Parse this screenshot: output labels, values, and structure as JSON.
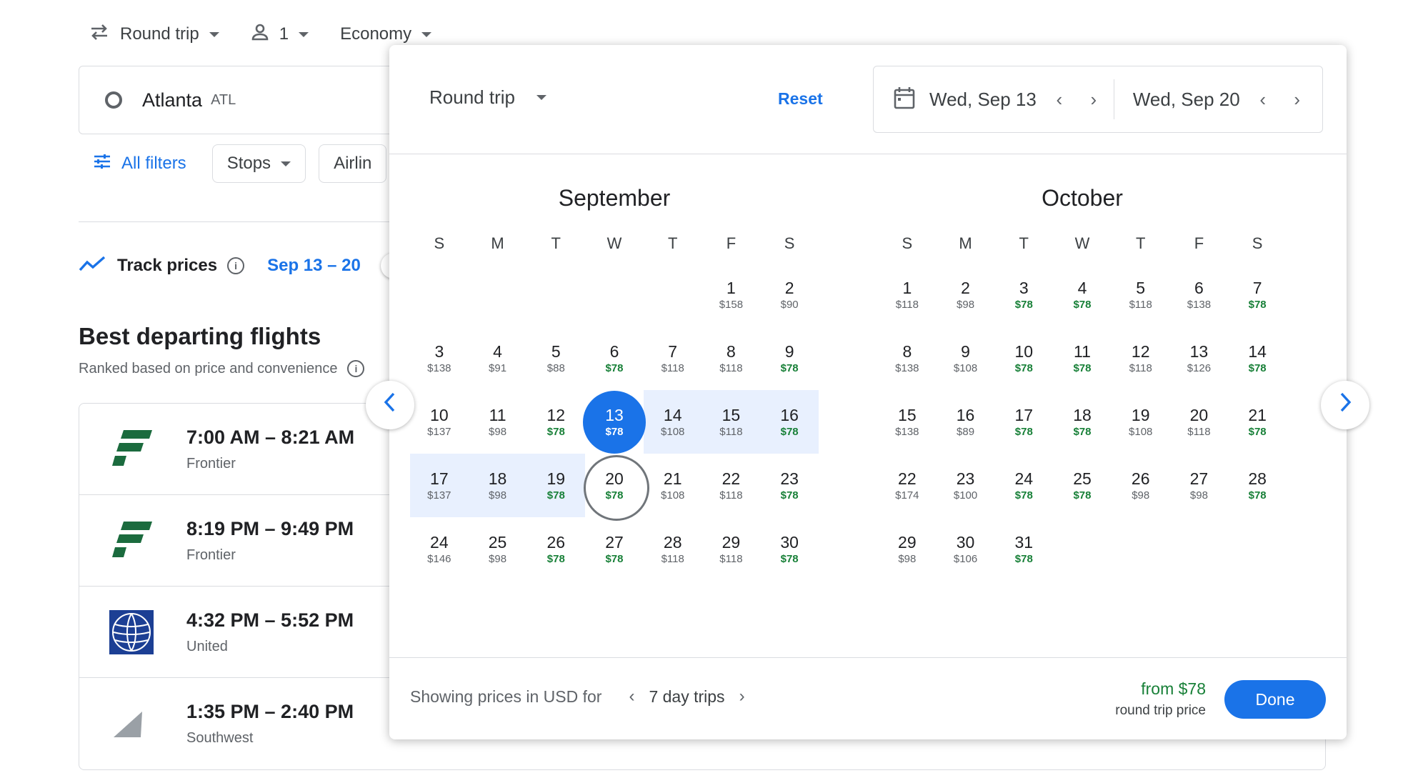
{
  "topbar": {
    "trip_type": "Round trip",
    "passengers": "1",
    "cabin": "Economy"
  },
  "search": {
    "origin_city": "Atlanta",
    "origin_code": "ATL"
  },
  "filters": {
    "all_filters": "All filters",
    "stops": "Stops",
    "airlines": "Airlin"
  },
  "track": {
    "label": "Track prices",
    "dates": "Sep 13 – 20"
  },
  "results": {
    "title": "Best departing flights",
    "subtitle": "Ranked based on price and convenience",
    "flights": [
      {
        "times": "7:00 AM – 8:21 AM",
        "airline": "Frontier"
      },
      {
        "times": "8:19 PM – 9:49 PM",
        "airline": "Frontier"
      },
      {
        "times": "4:32 PM – 5:52 PM",
        "airline": "United"
      },
      {
        "times": "1:35 PM – 2:40 PM",
        "airline": "Southwest"
      }
    ]
  },
  "popup": {
    "trip_type": "Round trip",
    "reset": "Reset",
    "depart_date": "Wed, Sep 13",
    "return_date": "Wed, Sep 20",
    "months": [
      {
        "name": "September",
        "weekdays": [
          "S",
          "M",
          "T",
          "W",
          "T",
          "F",
          "S"
        ],
        "days": [
          {
            "blank": true
          },
          {
            "blank": true
          },
          {
            "blank": true
          },
          {
            "blank": true
          },
          {
            "blank": true
          },
          {
            "d": "1",
            "p": "$158"
          },
          {
            "d": "2",
            "p": "$90"
          },
          {
            "d": "3",
            "p": "$138"
          },
          {
            "d": "4",
            "p": "$91"
          },
          {
            "d": "5",
            "p": "$88"
          },
          {
            "d": "6",
            "p": "$78",
            "low": true
          },
          {
            "d": "7",
            "p": "$118"
          },
          {
            "d": "8",
            "p": "$118"
          },
          {
            "d": "9",
            "p": "$78",
            "low": true
          },
          {
            "d": "10",
            "p": "$137"
          },
          {
            "d": "11",
            "p": "$98"
          },
          {
            "d": "12",
            "p": "$78",
            "low": true
          },
          {
            "d": "13",
            "p": "$78",
            "low": true,
            "state": "sel"
          },
          {
            "d": "14",
            "p": "$108",
            "state": "range"
          },
          {
            "d": "15",
            "p": "$118",
            "state": "range"
          },
          {
            "d": "16",
            "p": "$78",
            "low": true,
            "state": "range"
          },
          {
            "d": "17",
            "p": "$137",
            "state": "range"
          },
          {
            "d": "18",
            "p": "$98",
            "state": "range"
          },
          {
            "d": "19",
            "p": "$78",
            "low": true,
            "state": "range"
          },
          {
            "d": "20",
            "p": "$78",
            "low": true,
            "state": "end"
          },
          {
            "d": "21",
            "p": "$108"
          },
          {
            "d": "22",
            "p": "$118"
          },
          {
            "d": "23",
            "p": "$78",
            "low": true
          },
          {
            "d": "24",
            "p": "$146"
          },
          {
            "d": "25",
            "p": "$98"
          },
          {
            "d": "26",
            "p": "$78",
            "low": true
          },
          {
            "d": "27",
            "p": "$78",
            "low": true
          },
          {
            "d": "28",
            "p": "$118"
          },
          {
            "d": "29",
            "p": "$118"
          },
          {
            "d": "30",
            "p": "$78",
            "low": true
          }
        ]
      },
      {
        "name": "October",
        "weekdays": [
          "S",
          "M",
          "T",
          "W",
          "T",
          "F",
          "S"
        ],
        "days": [
          {
            "d": "1",
            "p": "$118"
          },
          {
            "d": "2",
            "p": "$98"
          },
          {
            "d": "3",
            "p": "$78",
            "low": true
          },
          {
            "d": "4",
            "p": "$78",
            "low": true
          },
          {
            "d": "5",
            "p": "$118"
          },
          {
            "d": "6",
            "p": "$138"
          },
          {
            "d": "7",
            "p": "$78",
            "low": true
          },
          {
            "d": "8",
            "p": "$138"
          },
          {
            "d": "9",
            "p": "$108"
          },
          {
            "d": "10",
            "p": "$78",
            "low": true
          },
          {
            "d": "11",
            "p": "$78",
            "low": true
          },
          {
            "d": "12",
            "p": "$118"
          },
          {
            "d": "13",
            "p": "$126"
          },
          {
            "d": "14",
            "p": "$78",
            "low": true
          },
          {
            "d": "15",
            "p": "$138"
          },
          {
            "d": "16",
            "p": "$89"
          },
          {
            "d": "17",
            "p": "$78",
            "low": true
          },
          {
            "d": "18",
            "p": "$78",
            "low": true
          },
          {
            "d": "19",
            "p": "$108"
          },
          {
            "d": "20",
            "p": "$118"
          },
          {
            "d": "21",
            "p": "$78",
            "low": true
          },
          {
            "d": "22",
            "p": "$174"
          },
          {
            "d": "23",
            "p": "$100"
          },
          {
            "d": "24",
            "p": "$78",
            "low": true
          },
          {
            "d": "25",
            "p": "$78",
            "low": true
          },
          {
            "d": "26",
            "p": "$98"
          },
          {
            "d": "27",
            "p": "$98"
          },
          {
            "d": "28",
            "p": "$78",
            "low": true
          },
          {
            "d": "29",
            "p": "$98"
          },
          {
            "d": "30",
            "p": "$106"
          },
          {
            "d": "31",
            "p": "$78",
            "low": true
          }
        ]
      }
    ],
    "footer": {
      "showing": "Showing prices in USD for",
      "trip_length": "7 day trips",
      "from_price": "from $78",
      "price_note": "round trip price",
      "done": "Done"
    }
  },
  "colors": {
    "accent": "#1a73e8",
    "low_price": "#188038",
    "range_bg": "#e8f0fe",
    "frontier_green": "#1b6b3e",
    "united_blue": "#1c3f94",
    "southwest_gray": "#9aa0a6"
  }
}
